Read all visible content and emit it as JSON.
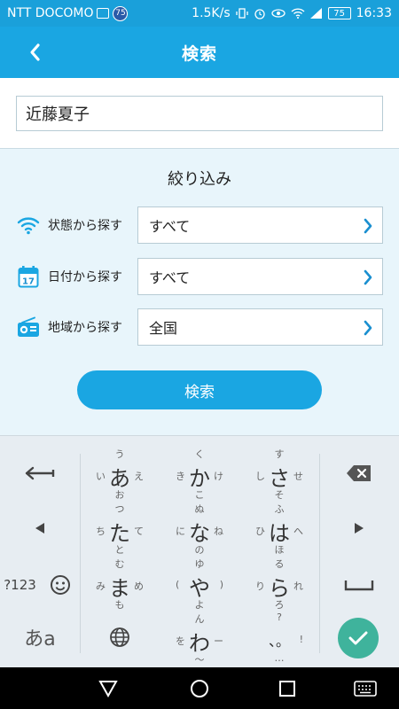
{
  "status_bar": {
    "carrier": "NTT DOCOMO",
    "notif_badge": "75",
    "speed": "1.5K/s",
    "battery": "75",
    "time": "16:33"
  },
  "app_bar": {
    "title": "検索",
    "back_icon": "chevron-left-icon"
  },
  "search": {
    "value": "近藤夏子"
  },
  "filter": {
    "heading": "絞り込み",
    "rows": [
      {
        "icon": "wifi-icon",
        "label": "状態から探す",
        "value": "すべて"
      },
      {
        "icon": "calendar-icon",
        "label": "日付から探す",
        "value": "すべて"
      },
      {
        "icon": "radio-icon",
        "label": "地域から探す",
        "value": "全国"
      }
    ]
  },
  "search_button": {
    "label": "検索"
  },
  "keyboard": {
    "left_keys": [
      "⟵",
      "◀",
      "?123",
      "☺",
      "あa"
    ],
    "right_keys": [
      "⌫",
      "▶",
      "␣",
      "✓"
    ],
    "kana": [
      {
        "c": "あ",
        "u": "う",
        "l": "い",
        "r": "え",
        "d": "お"
      },
      {
        "c": "か",
        "u": "く",
        "l": "き",
        "r": "け",
        "d": "こ"
      },
      {
        "c": "さ",
        "u": "す",
        "l": "し",
        "r": "せ",
        "d": "そ"
      },
      {
        "c": "た",
        "u": "つ",
        "l": "ち",
        "r": "て",
        "d": "と"
      },
      {
        "c": "な",
        "u": "ぬ",
        "l": "に",
        "r": "ね",
        "d": "の"
      },
      {
        "c": "は",
        "u": "ふ",
        "l": "ひ",
        "r": "へ",
        "d": "ほ"
      },
      {
        "c": "ま",
        "u": "む",
        "l": "み",
        "r": "め",
        "d": "も"
      },
      {
        "c": "や",
        "u": "ゆ",
        "l": "(",
        "r": ")",
        "d": "よ"
      },
      {
        "c": "ら",
        "u": "る",
        "l": "り",
        "r": "れ",
        "d": "ろ"
      },
      {
        "c": "わ",
        "u": "ん",
        "l": "を",
        "r": "ー",
        "d": "〜"
      },
      {
        "c": "、。",
        "u": "?",
        "l": "",
        "r": "!",
        "d": "…"
      }
    ],
    "accent_color": "#3fb39c"
  },
  "colors": {
    "primary": "#1aa6e2",
    "background": "#e8f5fb"
  }
}
